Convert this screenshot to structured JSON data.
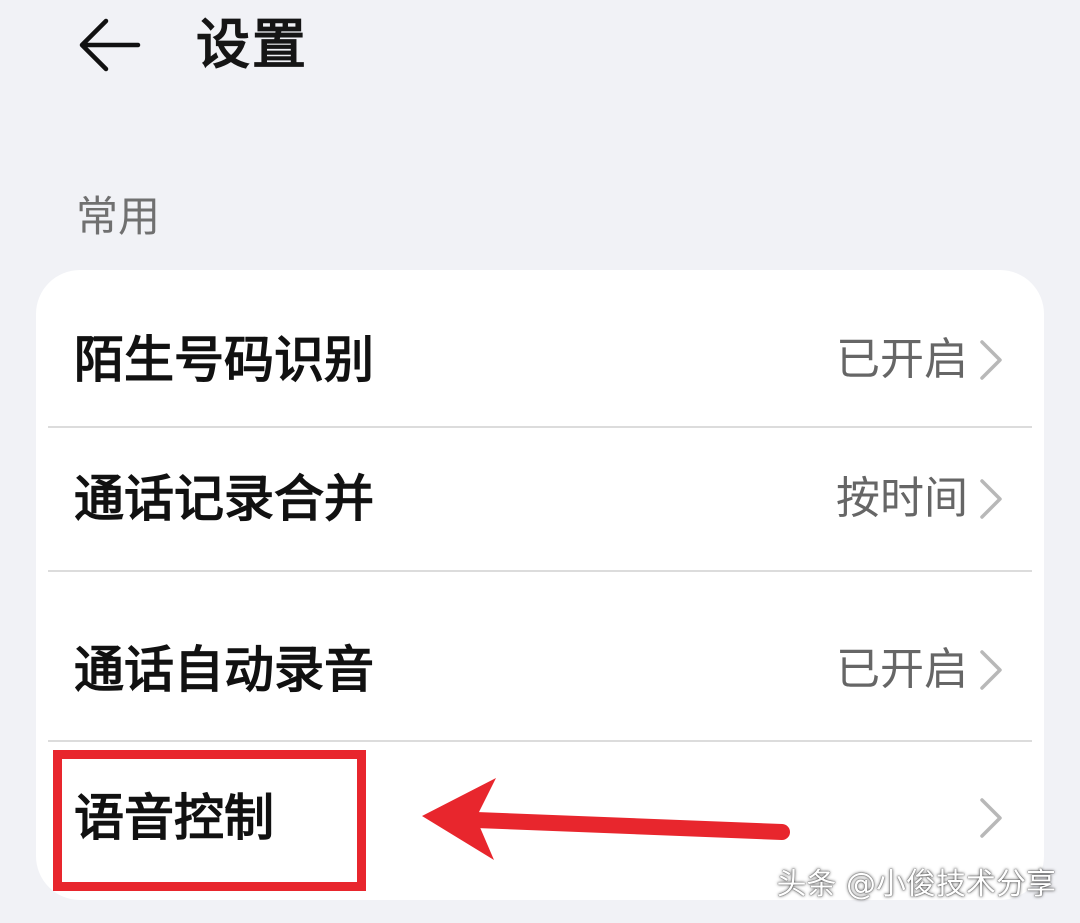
{
  "header": {
    "back_icon": "arrow-left-icon",
    "title": "设置"
  },
  "section": {
    "title": "常用"
  },
  "settings": [
    {
      "label": "陌生号码识别",
      "value": "已开启",
      "icon": "chevron-right-icon"
    },
    {
      "label": "通话记录合并",
      "value": "按时间",
      "icon": "chevron-right-icon"
    },
    {
      "label": "通话自动录音",
      "value": "已开启",
      "icon": "chevron-right-icon"
    },
    {
      "label": "语音控制",
      "value": "",
      "icon": "chevron-right-icon"
    }
  ],
  "annotation": {
    "highlight_color": "#e8262d",
    "pointer_icon": "arrow-left-red-icon"
  },
  "watermark": {
    "text": "头条 @小俊技术分享"
  },
  "colors": {
    "background": "#f1f2f6",
    "card": "#ffffff",
    "label": "#111111",
    "value": "#666666",
    "chevron": "#b8b8b8"
  }
}
